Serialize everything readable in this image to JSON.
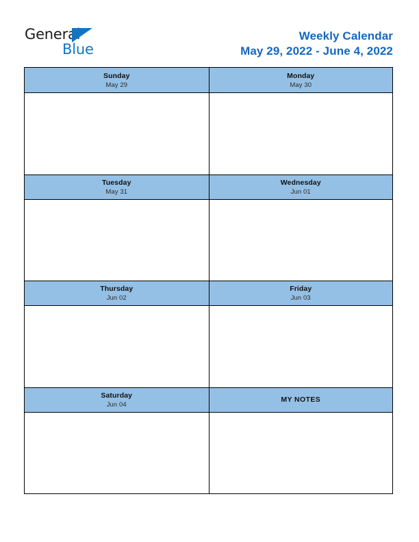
{
  "document": {
    "type": "weekly-calendar-printable"
  },
  "brand": {
    "name_part1": "General",
    "name_part2": "Blue",
    "triangle_icon": "triangle-icon",
    "color_dark": "#1b1b1b",
    "color_blue": "#1474c4"
  },
  "header": {
    "title": "Weekly Calendar",
    "date_range": "May 29, 2022 - June 4, 2022",
    "title_color": "#1566c0"
  },
  "theme": {
    "header_cell_bg": "#95c0e5",
    "border_color": "#000000",
    "page_bg": "#ffffff",
    "cell_bg": "#ffffff"
  },
  "calendar": {
    "rows": [
      {
        "left": {
          "day": "Sunday",
          "date": "May 29"
        },
        "right": {
          "day": "Monday",
          "date": "May 30"
        }
      },
      {
        "left": {
          "day": "Tuesday",
          "date": "May 31"
        },
        "right": {
          "day": "Wednesday",
          "date": "Jun 01"
        }
      },
      {
        "left": {
          "day": "Thursday",
          "date": "Jun 02"
        },
        "right": {
          "day": "Friday",
          "date": "Jun 03"
        }
      },
      {
        "left": {
          "day": "Saturday",
          "date": "Jun 04"
        },
        "right": {
          "day": "MY NOTES",
          "date": ""
        }
      }
    ]
  }
}
